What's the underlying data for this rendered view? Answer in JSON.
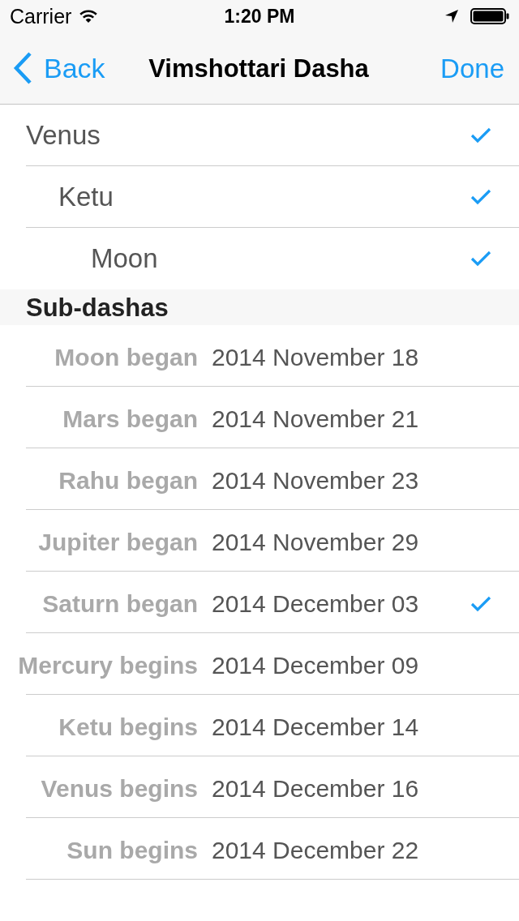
{
  "status_bar": {
    "carrier": "Carrier",
    "time": "1:20 PM"
  },
  "nav_bar": {
    "back": "Back",
    "title": "Vimshottari Dasha",
    "done": "Done"
  },
  "dashas": [
    {
      "name": "Venus",
      "checked": true,
      "children": [
        {
          "name": "Ketu",
          "checked": true,
          "children": [
            {
              "name": "Moon",
              "checked": true
            }
          ]
        }
      ]
    }
  ],
  "sub_dashas": {
    "header": "Sub-dashas",
    "rows": [
      {
        "label": "Moon began",
        "date": "2014 November 18",
        "checked": false
      },
      {
        "label": "Mars began",
        "date": "2014 November 21",
        "checked": false
      },
      {
        "label": "Rahu began",
        "date": "2014 November 23",
        "checked": false
      },
      {
        "label": "Jupiter began",
        "date": "2014 November 29",
        "checked": false
      },
      {
        "label": "Saturn began",
        "date": "2014 December 03",
        "checked": true
      },
      {
        "label": "Mercury begins",
        "date": "2014 December 09",
        "checked": false
      },
      {
        "label": "Ketu begins",
        "date": "2014 December 14",
        "checked": false
      },
      {
        "label": "Venus begins",
        "date": "2014 December 16",
        "checked": false
      },
      {
        "label": "Sun begins",
        "date": "2014 December 22",
        "checked": false
      }
    ]
  }
}
